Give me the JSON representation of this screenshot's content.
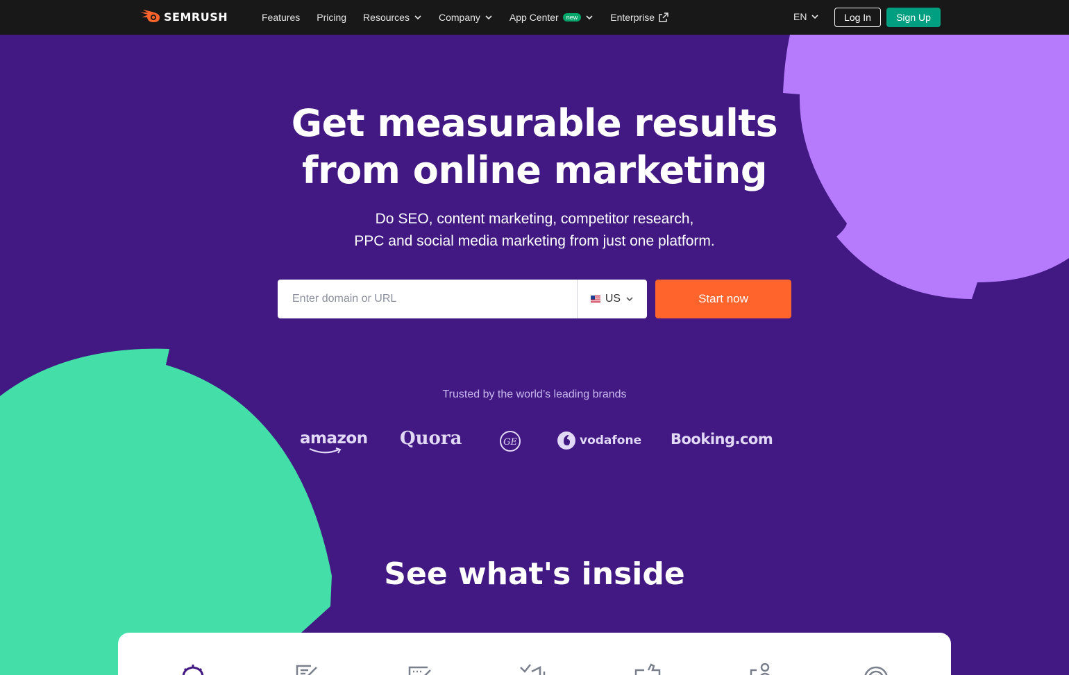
{
  "nav": {
    "logo_text": "SEMRUSH",
    "items": [
      {
        "label": "Features"
      },
      {
        "label": "Pricing"
      },
      {
        "label": "Resources"
      },
      {
        "label": "Company"
      },
      {
        "label": "App Center",
        "badge": "new"
      },
      {
        "label": "Enterprise"
      }
    ],
    "language": "EN",
    "login_label": "Log In",
    "signup_label": "Sign Up"
  },
  "hero": {
    "title_line1": "Get measurable results",
    "title_line2": "from online marketing",
    "subtitle_line1": "Do SEO, content marketing, competitor research,",
    "subtitle_line2": "PPC and social media marketing from just one platform.",
    "search_placeholder": "Enter domain or URL",
    "country": "US",
    "start_label": "Start now"
  },
  "trusted": {
    "label": "Trusted by the world’s leading brands",
    "brands": [
      "amazon",
      "Quora",
      "GE",
      "vodafone",
      "Booking.com"
    ]
  },
  "inside": {
    "title": "See what's inside",
    "icons": [
      "seo-icon",
      "content-icon",
      "local-icon",
      "advertising-icon",
      "social-icon",
      "ai-icon",
      "pr-icon"
    ]
  },
  "colors": {
    "background": "#421983",
    "nav": "#181818",
    "accent_orange": "#ff642d",
    "signup_green": "#009f81",
    "deco_purple": "#b57bfc",
    "deco_green": "#44dfa9"
  }
}
